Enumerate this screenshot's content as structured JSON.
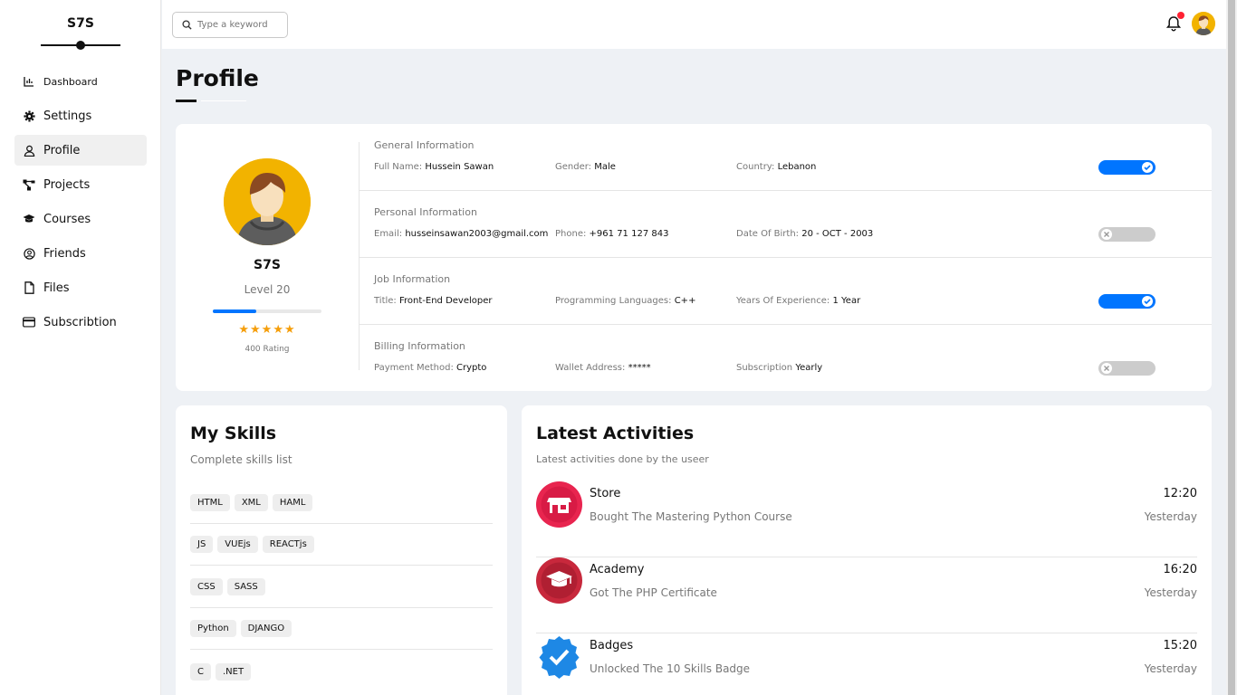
{
  "brand": {
    "logo_text": "S7S"
  },
  "sidebar": {
    "items": [
      {
        "label": "Dashboard",
        "icon": "chart-icon"
      },
      {
        "label": "Settings",
        "icon": "gear-icon"
      },
      {
        "label": "Profile",
        "icon": "user-icon"
      },
      {
        "label": "Projects",
        "icon": "diagram-icon"
      },
      {
        "label": "Courses",
        "icon": "graduation-cap-icon"
      },
      {
        "label": "Friends",
        "icon": "user-circle-icon"
      },
      {
        "label": "Files",
        "icon": "file-icon"
      },
      {
        "label": "Subscribtion",
        "icon": "credit-card-icon"
      }
    ],
    "active": "Profile"
  },
  "topbar": {
    "search_placeholder": "Type a keyword",
    "notifications": {
      "has_unread": true
    }
  },
  "page": {
    "title": "Profile"
  },
  "profile": {
    "name": "S7S",
    "level": "Level 20",
    "progress_percent": 40,
    "stars": "★★★★★",
    "rating_text": "400 Rating",
    "sections": [
      {
        "title": "General Information",
        "fields": [
          {
            "label": "Full Name:",
            "value": "Hussein Sawan"
          },
          {
            "label": "Gender:",
            "value": "Male"
          },
          {
            "label": "Country:",
            "value": "Lebanon"
          }
        ],
        "toggle_on": true
      },
      {
        "title": "Personal Information",
        "fields": [
          {
            "label": "Email:",
            "value": "husseinsawan2003@gmail.com"
          },
          {
            "label": "Phone:",
            "value": "+961 71 127 843"
          },
          {
            "label": "Date Of Birth:",
            "value": "20 - OCT - 2003"
          }
        ],
        "toggle_on": false
      },
      {
        "title": "Job Information",
        "fields": [
          {
            "label": "Title:",
            "value": "Front-End Developer"
          },
          {
            "label": "Programming Languages:",
            "value": "C++"
          },
          {
            "label": "Years Of Experience:",
            "value": "1 Year"
          }
        ],
        "toggle_on": true
      },
      {
        "title": "Billing Information",
        "fields": [
          {
            "label": "Payment Method:",
            "value": "Crypto"
          },
          {
            "label": "Wallet Address:",
            "value": "*****"
          },
          {
            "label": "Subscription",
            "value": "Yearly"
          }
        ],
        "toggle_on": false
      }
    ]
  },
  "skills": {
    "title": "My Skills",
    "subtitle": "Complete skills list",
    "rows": [
      [
        "HTML",
        "XML",
        "HAML"
      ],
      [
        "JS",
        "VUEjs",
        "REACTjs"
      ],
      [
        "CSS",
        "SASS"
      ],
      [
        "Python",
        "DJANGO"
      ],
      [
        "C",
        ".NET"
      ]
    ]
  },
  "activities": {
    "title": "Latest Activities",
    "subtitle": "Latest activities done by the useer",
    "items": [
      {
        "name": "Store",
        "desc": "Bought The Mastering Python Course",
        "time": "12:20",
        "day": "Yesterday",
        "icon": "store-icon",
        "color": "#e91e4f"
      },
      {
        "name": "Academy",
        "desc": "Got The PHP Certificate",
        "time": "16:20",
        "day": "Yesterday",
        "icon": "graduation-cap-icon",
        "color": "#c0263a"
      },
      {
        "name": "Badges",
        "desc": "Unlocked The 10 Skills Badge",
        "time": "15:20",
        "day": "Yesterday",
        "icon": "badge-check-icon",
        "color": "#1e88e5"
      }
    ]
  }
}
